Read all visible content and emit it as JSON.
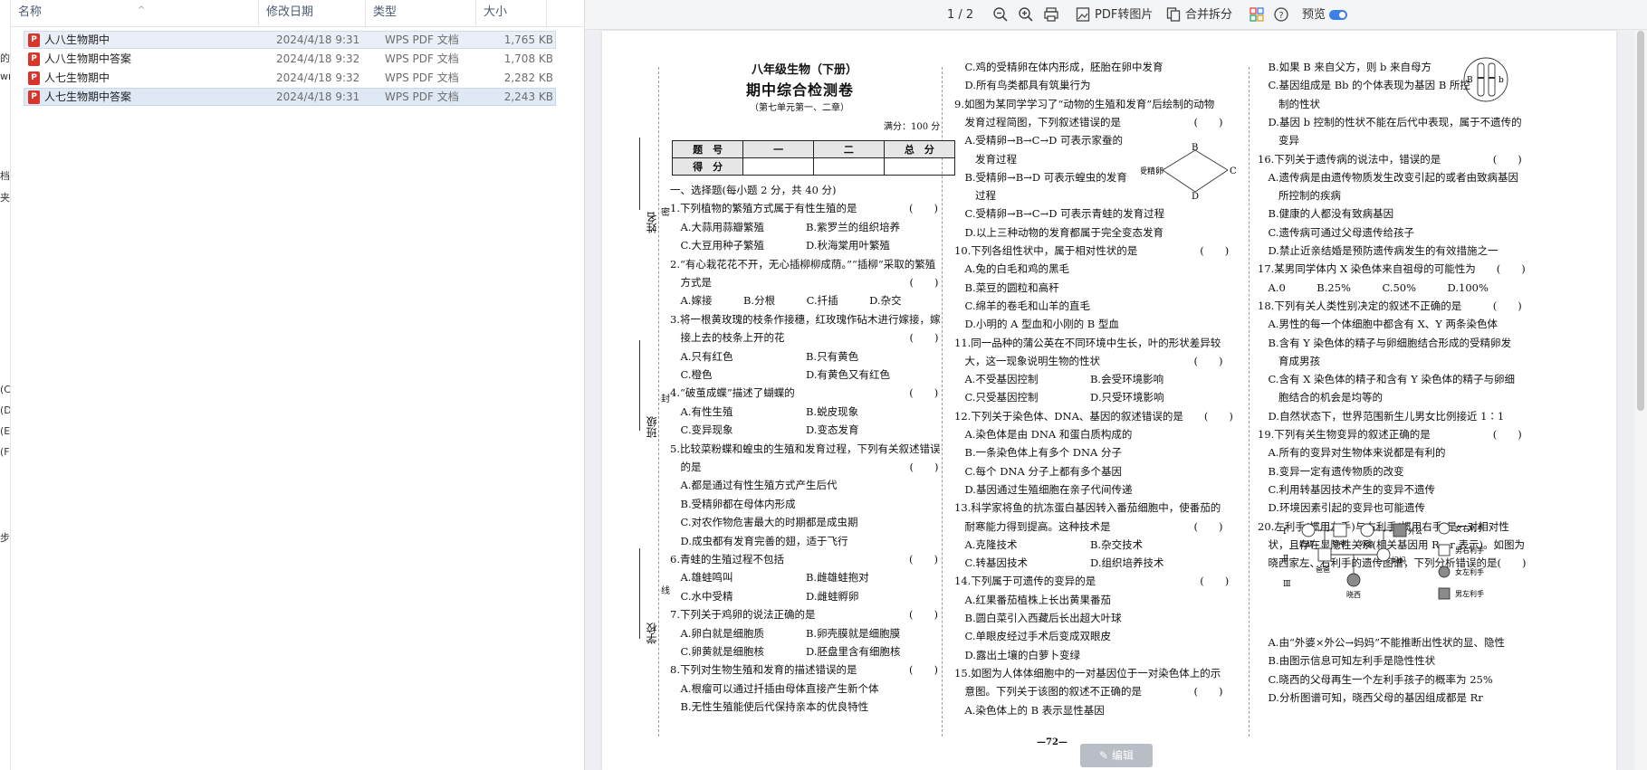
{
  "explorer": {
    "columns": {
      "name": "名称",
      "date": "修改日期",
      "type": "类型",
      "size": "大小"
    },
    "files": [
      {
        "name": "人八生物期中",
        "date": "2024/4/18 9:31",
        "type": "WPS PDF 文档",
        "size": "1,765 KB"
      },
      {
        "name": "人八生物期中答案",
        "date": "2024/4/18 9:32",
        "type": "WPS PDF 文档",
        "size": "1,708 KB"
      },
      {
        "name": "人七生物期中",
        "date": "2024/4/18 9:32",
        "type": "WPS PDF 文档",
        "size": "2,282 KB"
      },
      {
        "name": "人七生物期中答案",
        "date": "2024/4/18 9:31",
        "type": "WPS PDF 文档",
        "size": "2,243 KB"
      }
    ],
    "left_strip": [
      "的",
      "wn",
      "档",
      "夹",
      "(C",
      "(D",
      "(E",
      "(F",
      "步"
    ]
  },
  "toolbar": {
    "page_counter": "1 / 2",
    "pdf_to_image": "PDF转图片",
    "merge_split": "合并拆分",
    "preview": "预览"
  },
  "edit_button": "编辑",
  "paper": {
    "title1": "八年级生物（下册）",
    "title2": "期中综合检测卷",
    "title3": "（第七单元第一、二章）",
    "full_mark": "满分：100 分",
    "score_table": {
      "h1": "题　号",
      "h2": "一",
      "h3": "二",
      "h4": "总　分",
      "r1": "得　分"
    },
    "binding": {
      "name": "姓名",
      "class": "班级",
      "school": "学校",
      "seal1": "密",
      "seal2": "封",
      "seal3": "线"
    },
    "page_number": "—72—",
    "col1": [
      "一、选择题(每小题 2 分，共 40 分)",
      "1.下列植物的繁殖方式属于有性生殖的是　　　　　(　　)",
      "　A.大蒜用蒜瓣繁殖　　　　B.紫罗兰的组织培养",
      "　C.大豆用种子繁殖　　　　D.秋海棠用叶繁殖",
      "2.“有心栽花花不开，无心插柳柳成荫。”“插柳”采取的繁殖",
      "　方式是　　　　　　　　　　　　　　　　　　　(　　)",
      "　A.嫁接　　　B.分根　　　C.扦插　　　D.杂交",
      "3.将一根黄玫瑰的枝条作接穗，红玫瑰作砧木进行嫁接，嫁",
      "　接上去的枝条上开的花　　　　　　　　　　　　(　　)",
      "　A.只有红色　　　　　　　B.只有黄色",
      "　C.橙色　　　　　　　　　D.有黄色又有红色",
      "4.“破茧成蝶”描述了蝴蝶的　　　　　　　　　　　(　　)",
      "　A.有性生殖　　　　　　　B.蜕皮现象",
      "　C.变异现象　　　　　　　D.变态发育",
      "5.比较菜粉蝶和蝗虫的生殖和发育过程，下列有关叙述错误",
      "　的是　　　　　　　　　　　　　　　　　　　　(　　)",
      "　A.都是通过有性生殖方式产生后代",
      "　B.受精卵都在母体内形成",
      "　C.对农作物危害最大的时期都是成虫期",
      "　D.成虫都有发育完善的翅，适于飞行",
      "6.青蛙的生殖过程不包括　　　　　　　　　　　　(　　)",
      "　A.雄蛙鸣叫　　　　　　　B.雌雄蛙抱对",
      "　C.水中受精　　　　　　　D.雌蛙孵卵",
      "7.下列关于鸡卵的说法正确的是　　　　　　　　　(　　)",
      "　A.卵白就是细胞质　　　　B.卵壳膜就是细胞膜",
      "　C.卵黄就是细胞核　　　　D.胚盘里含有细胞核",
      "8.下列对生物生殖和发育的描述错误的是　　　　　(　　)",
      "　A.根瘤可以通过扦插由母体直接产生新个体",
      "　B.无性生殖能使后代保持亲本的优良特性"
    ],
    "col2": [
      "　C.鸡的受精卵在体内形成，胚胎在卵中发育",
      "　D.所有鸟类都具有筑巢行为",
      "9.如图为某同学学习了“动物的生殖和发育”后绘制的动物",
      "　发育过程简图，下列叙述错误的是　　　　　　　(　　)",
      "　A.受精卵→B→C→D 可表示家蚕的",
      "　　发育过程",
      "　B.受精卵→B→D 可表示蝗虫的发育",
      "　　过程",
      "　C.受精卵→B→C→D 可表示青蛙的发育过程",
      "　D.以上三种动物的发育都属于完全变态发育",
      "10.下列各组性状中，属于相对性状的是　　　　　　(　　)",
      "　A.兔的白毛和鸡的黑毛",
      "　B.菜豆的圆粒和高秆",
      "　C.绵羊的卷毛和山羊的直毛",
      "　D.小明的 A 型血和小刚的 B 型血",
      "11.同一品种的蒲公英在不同环境中生长，叶的形状差异较",
      "　大，这一现象说明生物的性状　　　　　　　　　(　　)",
      "　A.不受基因控制　　　　　B.会受环境影响",
      "　C.只受基因控制　　　　　D.只受环境影响",
      "12.下列关于染色体、DNA、基因的叙述错误的是　　(　　)",
      "　A.染色体是由 DNA 和蛋白质构成的",
      "　B.一条染色体上有多个 DNA 分子",
      "　C.每个 DNA 分子上都有多个基因",
      "　D.基因通过生殖细胞在亲子代间传递",
      "13.科学家将鱼的抗冻蛋白基因转入番茄细胞中，使番茄的",
      "　耐寒能力得到提高。这种技术是　　　　　　　　(　　)",
      "　A.克隆技术　　　　　　　B.杂交技术",
      "　C.转基因技术　　　　　　D.组织培养技术",
      "14.下列属于可遗传的变异的是　　　　　　　　　　(　　)",
      "　A.红果番茄植株上长出黄果番茄",
      "　B.圆白菜引入西藏后长出超大叶球",
      "　C.单眼皮经过手术后变成双眼皮",
      "　D.露出土壤的白萝卜变绿",
      "15.如图为人体体细胞中的一对基因位于一对染色体上的示",
      "　意图。下列关于该图的叙述不正确的是　　　　　(　　)",
      "　A.染色体上的 B 表示显性基因"
    ],
    "col3": [
      "　B.如果 B 来自父方，则 b 来自母方",
      "　C.基因组成是 Bb 的个体表现为基因 B 所控",
      "　　制的性状",
      "　D.基因 b 控制的性状不能在后代中表现，属于不遗传的",
      "　　变异",
      "16.下列关于遗传病的说法中，错误的是　　　　　(　　)",
      "　A.遗传病是由遗传物质发生改变引起的或者由致病基因",
      "　　所控制的疾病",
      "　B.健康的人都没有致病基因",
      "　C.遗传病可通过父母遗传给孩子",
      "　D.禁止近亲结婚是预防遗传病发生的有效措施之一",
      "17.某男同学体内 X 染色体来自祖母的可能性为　　(　　)",
      "　A.0　　　B.25%　　　C.50%　　　D.100%",
      "18.下列有关人类性别决定的叙述不正确的是　　　(　　)",
      "　A.男性的每一个体细胞中都含有 X、Y 两条染色体",
      "　B.含有 Y 染色体的精子与卵细胞结合形成的受精卵发",
      "　　育成男孩",
      "　C.含有 X 染色体的精子和含有 Y 染色体的精子与卵细",
      "　　胞结合的机会是均等的",
      "　D.自然状态下，世界范围新生儿男女比例接近 1∶1",
      "19.下列有关生物变异的叙述正确的是　　　　　　(　　)",
      "　A.所有的变异对生物体来说都是有利的",
      "　B.变异一定有遗传物质的改变",
      "　C.利用转基因技术产生的变异不遗传",
      "　D.环境因素引起的变异也可能遗传",
      "20.左利手(惯用左手)与右利手(惯用右手)是一对相对性",
      "　状，且存在显隐性关系(相关基因用 R、r 表示)。如图为",
      "　晓西家左、右利手的遗传图谱，下列分析错误的是(　　)"
    ],
    "col3_bottom": [
      "　A.由“外婆×外公→妈妈”不能推断出性状的显、隐性",
      "　B.由图示信息可知左利手是隐性性状",
      "　C.晓西的父母再生一个左利手孩子的概率为 25%",
      "　D.分析图谱可知，晓西父母的基因组成都是 Rr"
    ],
    "figure9": {
      "b": "B",
      "c": "C",
      "d": "D",
      "egg": "受精卵"
    },
    "figure15": {
      "b1": "B",
      "b2": "b"
    },
    "pedigree": {
      "gen1": "Ⅰ",
      "gen2": "Ⅱ",
      "gen3": "Ⅲ",
      "grandma": "奶奶",
      "grandpa": "爷爷",
      "waipo": "外婆",
      "waigong": "外公",
      "dad": "爸爸",
      "mom": "妈妈",
      "kid": "晓西",
      "legend1": "女右利手",
      "legend2": "男右利手",
      "legend3": "女左利手",
      "legend4": "男左利手"
    }
  }
}
